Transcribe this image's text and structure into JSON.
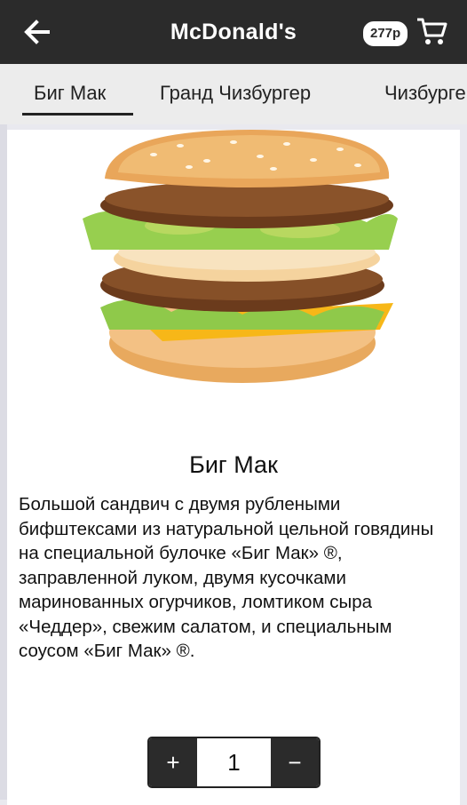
{
  "header": {
    "title": "McDonald's",
    "price": "277р"
  },
  "tabs": [
    {
      "label": "Биг Мак"
    },
    {
      "label": "Гранд Чизбургер"
    },
    {
      "label": "Чизбургер"
    }
  ],
  "product": {
    "name": "Биг Мак",
    "description": "Большой сандвич с двумя рублеными бифштексами из натуральной цельной говядины на специальной булочке «Биг Мак» ®, заправленной луком, двумя кусочками маринованных огурчиков, ломтиком сыра «Чеддер», свежим салатом, и специальным соусом «Биг Мак» ®."
  },
  "quantity": {
    "plus": "+",
    "value": "1",
    "minus": "−"
  },
  "icons": {
    "back": "arrow-left-icon",
    "cart": "shopping-cart-icon"
  }
}
